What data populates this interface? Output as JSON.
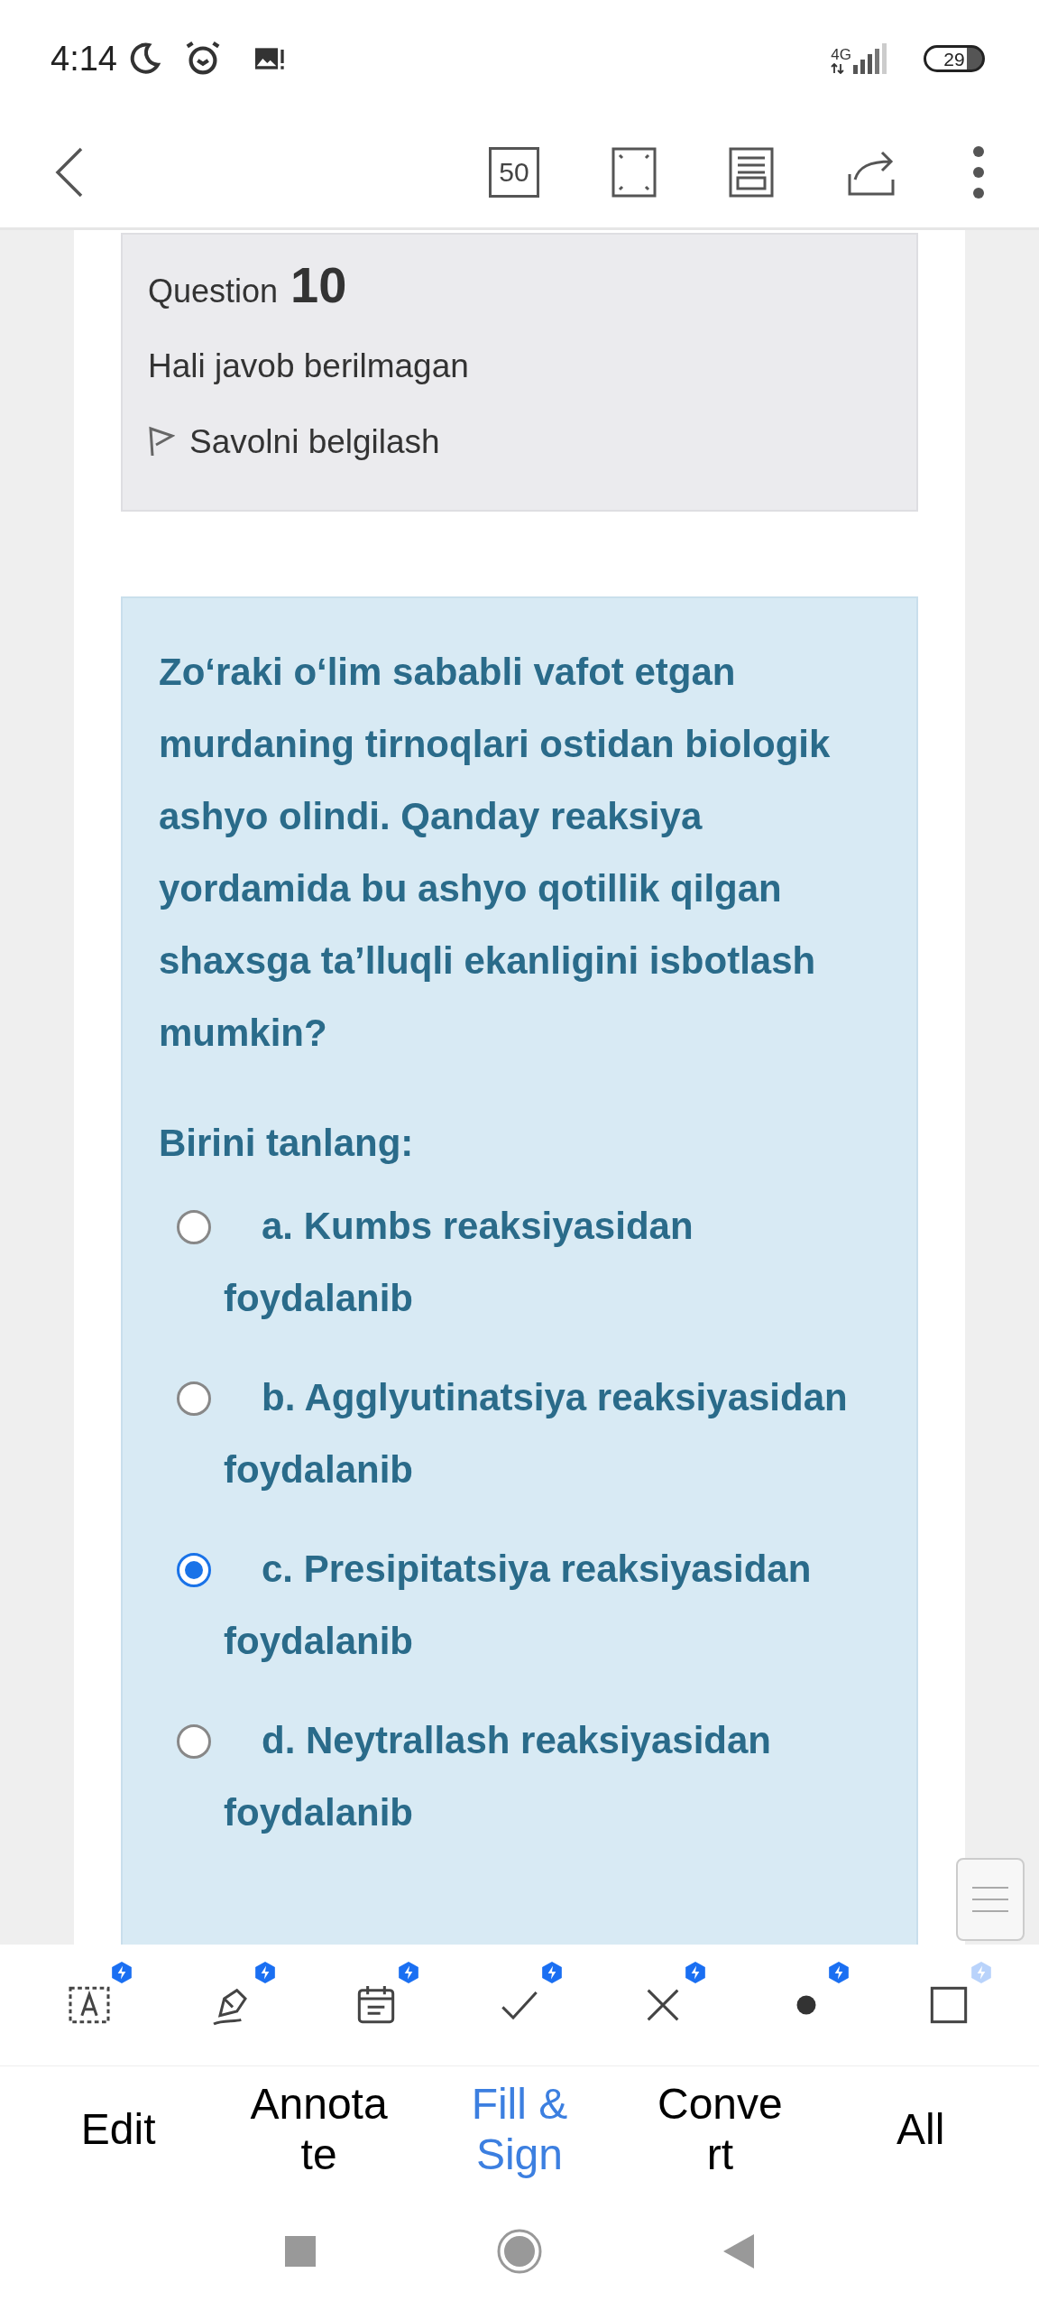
{
  "status_bar": {
    "time": "4:14",
    "network": "4G",
    "battery": "29"
  },
  "toolbar": {
    "page_count": "50"
  },
  "question_info": {
    "label": "Question",
    "number": "10",
    "state": "Hali javob berilmagan",
    "flag": "Savolni belgilash"
  },
  "question": {
    "text": "Zoʻraki oʻlim sababli vafot etgan murdaning tirnoqlari ostidan biologik ashyo olindi. Qanday reaksiya yordamida bu ashyo qotillik qilgan shaxsga ta’lluqli ekanligini isbotlash mumkin?",
    "prompt": "Birini tanlang:",
    "options": [
      {
        "text": "a. Kumbs reaksiyasidan foydalanib",
        "selected": false
      },
      {
        "text": "b. Agglyutinatsiya reaksiyasidan foydalanib",
        "selected": false
      },
      {
        "text": "c. Presipitatsiya reaksiyasidan foydalanib",
        "selected": true
      },
      {
        "text": "d. Neytrallash reaksiyasidan foydalanib",
        "selected": false
      }
    ]
  },
  "tools": [
    {
      "kind": "text"
    },
    {
      "kind": "pen"
    },
    {
      "kind": "date"
    },
    {
      "kind": "check"
    },
    {
      "kind": "cross"
    },
    {
      "kind": "dot"
    },
    {
      "kind": "square"
    }
  ],
  "tabs": [
    {
      "lines": [
        "Edit"
      ],
      "selected": false
    },
    {
      "lines": [
        "Annota",
        "te"
      ],
      "selected": false
    },
    {
      "lines": [
        "Fill &",
        "Sign"
      ],
      "selected": true
    },
    {
      "lines": [
        "Conve",
        "rt"
      ],
      "selected": false
    },
    {
      "lines": [
        "All"
      ],
      "selected": false
    }
  ]
}
